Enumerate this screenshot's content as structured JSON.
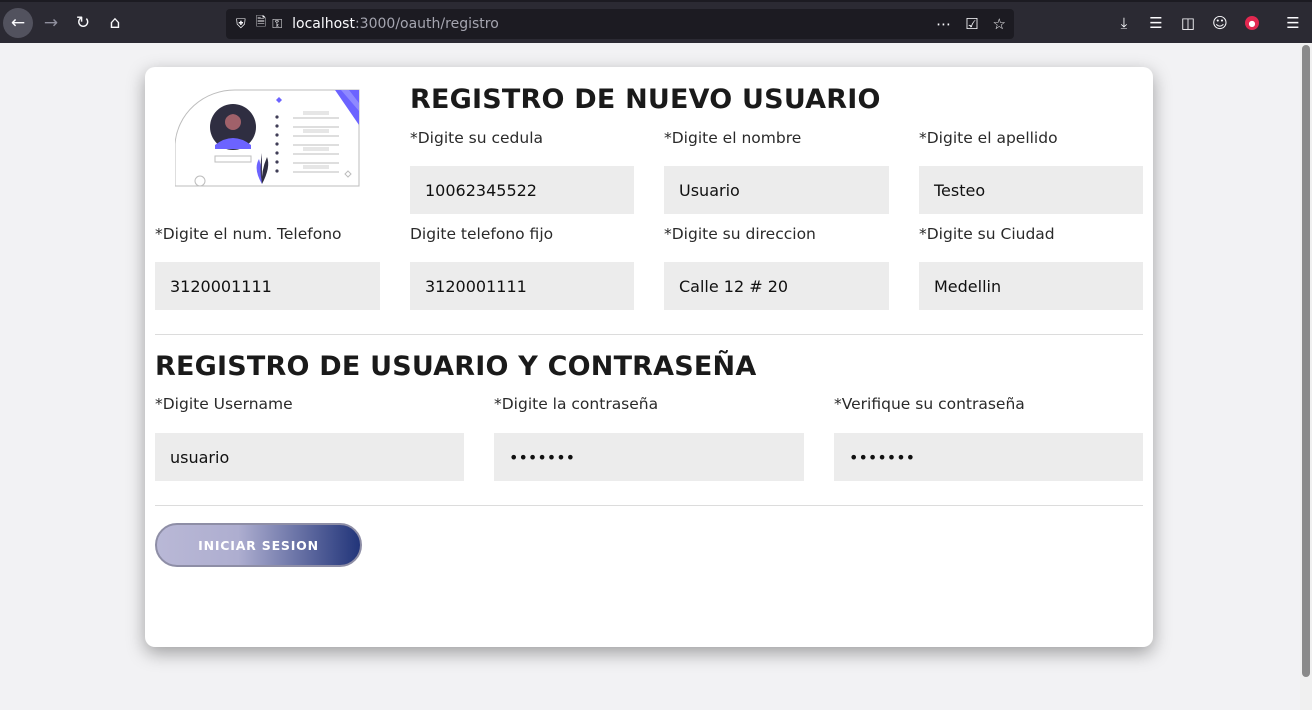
{
  "browser": {
    "url_host": "localhost",
    "url_path": ":3000/oauth/registro"
  },
  "form": {
    "title_personal": "REGISTRO DE NUEVO USUARIO",
    "title_account": "REGISTRO DE USUARIO Y CONTRASEÑA",
    "fields": {
      "cedula": {
        "label": "*Digite su cedula",
        "value": "10062345522"
      },
      "nombre": {
        "label": "*Digite el nombre",
        "value": "Usuario"
      },
      "apellido": {
        "label": "*Digite el apellido",
        "value": "Testeo"
      },
      "telefono": {
        "label": "*Digite el num. Telefono",
        "value": "3120001111"
      },
      "telefono_fijo": {
        "label": "Digite telefono fijo",
        "value": "3120001111"
      },
      "direccion": {
        "label": "*Digite su direccion",
        "value": "Calle 12 # 20"
      },
      "ciudad": {
        "label": "*Digite su Ciudad",
        "value": "Medellin"
      },
      "username": {
        "label": "*Digite Username",
        "value": "usuario"
      },
      "password": {
        "label": "*Digite la contraseña",
        "value": "•••••••"
      },
      "password_confirm": {
        "label": "*Verifique su contraseña",
        "value": "•••••••"
      }
    },
    "submit_label": "INICIAR SESION"
  },
  "colors": {
    "accent_purple": "#6c63ff",
    "button_gradient_end": "#22357a"
  }
}
